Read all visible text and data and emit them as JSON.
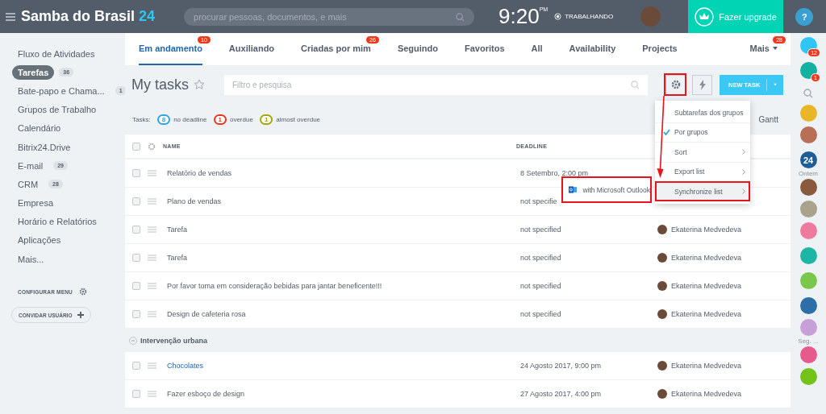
{
  "header": {
    "logo": "Samba do Brasil",
    "logo_number": "24",
    "search_placeholder": "procurar pessoas, documentos, e mais",
    "time": "9:20",
    "time_suffix": "PM",
    "status": "TRABALHANDO",
    "upgrade": "Fazer upgrade",
    "help": "?"
  },
  "sidebar": {
    "items": [
      {
        "label": "Fluxo de Atividades",
        "selected": false
      },
      {
        "label": "Tarefas",
        "count": "36",
        "selected": true
      },
      {
        "label": "Bate-papo e Chama...",
        "count": "1",
        "selected": false
      },
      {
        "label": "Grupos de Trabalho",
        "selected": false
      },
      {
        "label": "Calendário",
        "selected": false
      },
      {
        "label": "Bitrix24.Drive",
        "selected": false
      },
      {
        "label": "E-mail",
        "count": "29",
        "selected": false
      },
      {
        "label": "CRM",
        "count": "28",
        "selected": false
      },
      {
        "label": "Empresa",
        "selected": false
      },
      {
        "label": "Horário e Relatórios",
        "selected": false
      },
      {
        "label": "Aplicações",
        "selected": false
      },
      {
        "label": "Mais...",
        "selected": false
      }
    ],
    "configure": "CONFIGURAR MENU",
    "invite": "CONVIDAR USUÁRIO"
  },
  "tabs": [
    {
      "label": "Em andamento",
      "badge": "10",
      "selected": true
    },
    {
      "label": "Auxiliando",
      "selected": false
    },
    {
      "label": "Criadas por mim",
      "badge": "26",
      "selected": false
    },
    {
      "label": "Seguindo",
      "selected": false
    },
    {
      "label": "Favoritos",
      "selected": false
    },
    {
      "label": "All",
      "selected": false
    },
    {
      "label": "Availability",
      "selected": false
    },
    {
      "label": "Projects",
      "selected": false
    }
  ],
  "more_tab": {
    "label": "Mais",
    "badge": "28"
  },
  "title": "My tasks",
  "filter_placeholder": "Filtro e pesquisa",
  "new_task": "NEW TASK",
  "counters": {
    "label": "Tasks:",
    "items": [
      {
        "count": "8",
        "text": "no deadline",
        "color": "#2fa4e7"
      },
      {
        "count": "1",
        "text": "overdue",
        "color": "#f0371b"
      },
      {
        "count": "1",
        "text": "almost overdue",
        "color": "#a5a500"
      }
    ],
    "view": "Gantt"
  },
  "table": {
    "columns": [
      "NAME",
      "DEADLINE"
    ],
    "all_checked": false,
    "rows": [
      {
        "kind": "task",
        "checked": false,
        "name": "Relatório de vendas",
        "deadline": "8 Setembro, 2:00 pm"
      },
      {
        "kind": "task",
        "checked": false,
        "name": "Plano de vendas",
        "deadline": "not specifie"
      },
      {
        "kind": "task",
        "checked": false,
        "name": "Tarefa",
        "deadline": "not specified",
        "responsible": "Ekaterina Medvedeva"
      },
      {
        "kind": "task",
        "checked": false,
        "name": "Tarefa",
        "deadline": "not specified",
        "responsible": "Ekaterina Medvedeva"
      },
      {
        "kind": "task",
        "checked": false,
        "name": "Por favor toma em consideração bebidas para jantar beneficente!!!",
        "deadline": "not specified",
        "responsible": "Ekaterina Medvedeva"
      },
      {
        "kind": "task",
        "checked": false,
        "name": "Design de cafeteria rosa",
        "deadline": "not specified",
        "responsible": "Ekaterina Medvedeva"
      },
      {
        "kind": "group",
        "name": "Intervenção urbana"
      },
      {
        "kind": "task",
        "checked": false,
        "name": "Chocolates",
        "link": true,
        "deadline": "24 Agosto 2017, 9:00 pm",
        "responsible": "Ekaterina Medvedeva"
      },
      {
        "kind": "task",
        "checked": false,
        "name": "Fazer esboço de design",
        "deadline": "27 Agosto 2017, 4:00 pm",
        "responsible": "Ekaterina Medvedeva"
      }
    ]
  },
  "menu": {
    "items": [
      {
        "label": "Subtarefas dos grupos",
        "checked": false,
        "submenu": false,
        "selected": false
      },
      {
        "label": "Por grupos",
        "checked": true,
        "submenu": false,
        "selected": false
      },
      {
        "label": "Sort",
        "checked": false,
        "submenu": true,
        "selected": false
      },
      {
        "label": "Export list",
        "checked": false,
        "submenu": true,
        "selected": false
      },
      {
        "label": "Synchronize list",
        "checked": false,
        "submenu": true,
        "selected": true
      }
    ],
    "submenu": "with Microsoft Outlook"
  },
  "right_bar": [
    {
      "kind": "icon",
      "color": "#2fc6f6",
      "badge": "12"
    },
    {
      "kind": "icon",
      "color": "#12b1a0",
      "badge": "1"
    },
    {
      "kind": "search"
    },
    {
      "kind": "avatar",
      "color": "#e8b628"
    },
    {
      "kind": "icon",
      "color": "#b86f55"
    },
    {
      "kind": "number",
      "color": "#1f5d96",
      "text": "24"
    },
    {
      "kind": "label",
      "text": "Ontem"
    },
    {
      "kind": "avatar",
      "color": "#8a5a3c"
    },
    {
      "kind": "avatar",
      "color": "#a9a38e"
    },
    {
      "kind": "icon",
      "color": "#ee7a9e"
    },
    {
      "kind": "icon",
      "color": "#1fb5a5"
    },
    {
      "kind": "icon",
      "color": "#79c84c"
    },
    {
      "kind": "avatar",
      "color": "#2c6fa8"
    },
    {
      "kind": "avatar",
      "color": "#c8a0d8"
    },
    {
      "kind": "label",
      "text": "Seg. ..."
    },
    {
      "kind": "avatar",
      "color": "#e65a8c"
    },
    {
      "kind": "icon",
      "color": "#73c31b"
    }
  ]
}
